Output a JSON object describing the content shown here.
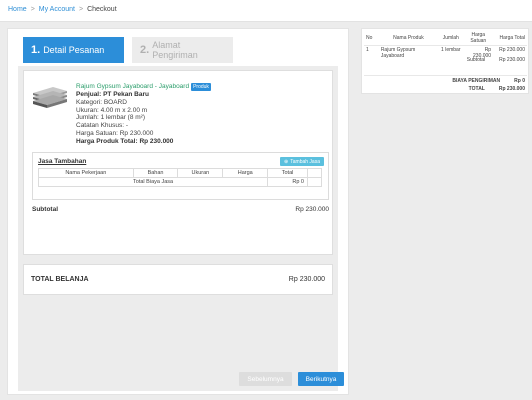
{
  "breadcrumb": {
    "home": "Home",
    "account": "My Account",
    "current": "Checkout",
    "separator": ">"
  },
  "steps": [
    {
      "num": "1.",
      "label": "Detail Pesanan"
    },
    {
      "num": "2.",
      "label": "Alamat Pengiriman"
    }
  ],
  "product": {
    "name": "Rajum Gypsum Jayaboard - Jayaboard",
    "badge": "Produk",
    "seller": "Penjual: PT Pekan Baru",
    "category": "Kategori: BOARD",
    "size": "Ukuran: 4.00 m x 2.00 m",
    "quantity": "Jumlah: 1 lembar (8 m²)",
    "note": "Catatan Khusus: -",
    "unit_price": "Harga Satuan: Rp 230.000",
    "total_price": "Harga Produk Total: Rp 230.000"
  },
  "jasa": {
    "title": "Jasa Tambahan",
    "add_button": "Tambah Jasa",
    "headers": [
      "Nama Pekerjaan",
      "Bahan",
      "Ukuran",
      "Harga",
      "Total"
    ],
    "total_label": "Total Biaya Jasa",
    "total_value": "Rp 0"
  },
  "subtotal": {
    "label": "Subtotal",
    "value": "Rp 230.000"
  },
  "total": {
    "label": "TOTAL BELANJA",
    "value": "Rp 230.000"
  },
  "buttons": {
    "prev": "Sebelumnya",
    "next": "Berikutnya"
  },
  "summary": {
    "headers": [
      "No",
      "Nama Produk",
      "Jumlah",
      "Harga Satuan",
      "Harga Total"
    ],
    "row": {
      "no": "1",
      "name": "Rajum Gypsum Jayaboard",
      "qty": "1 lembar",
      "unit": "Rp 230.000",
      "total": "Rp 230.000"
    },
    "subtotal_label": "Subtotal",
    "subtotal_value": "Rp 230.000",
    "shipping_label": "BIAYA PENGIRIMAN",
    "shipping_value": "Rp 0",
    "total_label": "TOTAL",
    "total_value": "Rp 230.000"
  },
  "colors": {
    "primary": "#2c8ed9",
    "info": "#5bc0de",
    "product_name": "#2a9d6a"
  }
}
